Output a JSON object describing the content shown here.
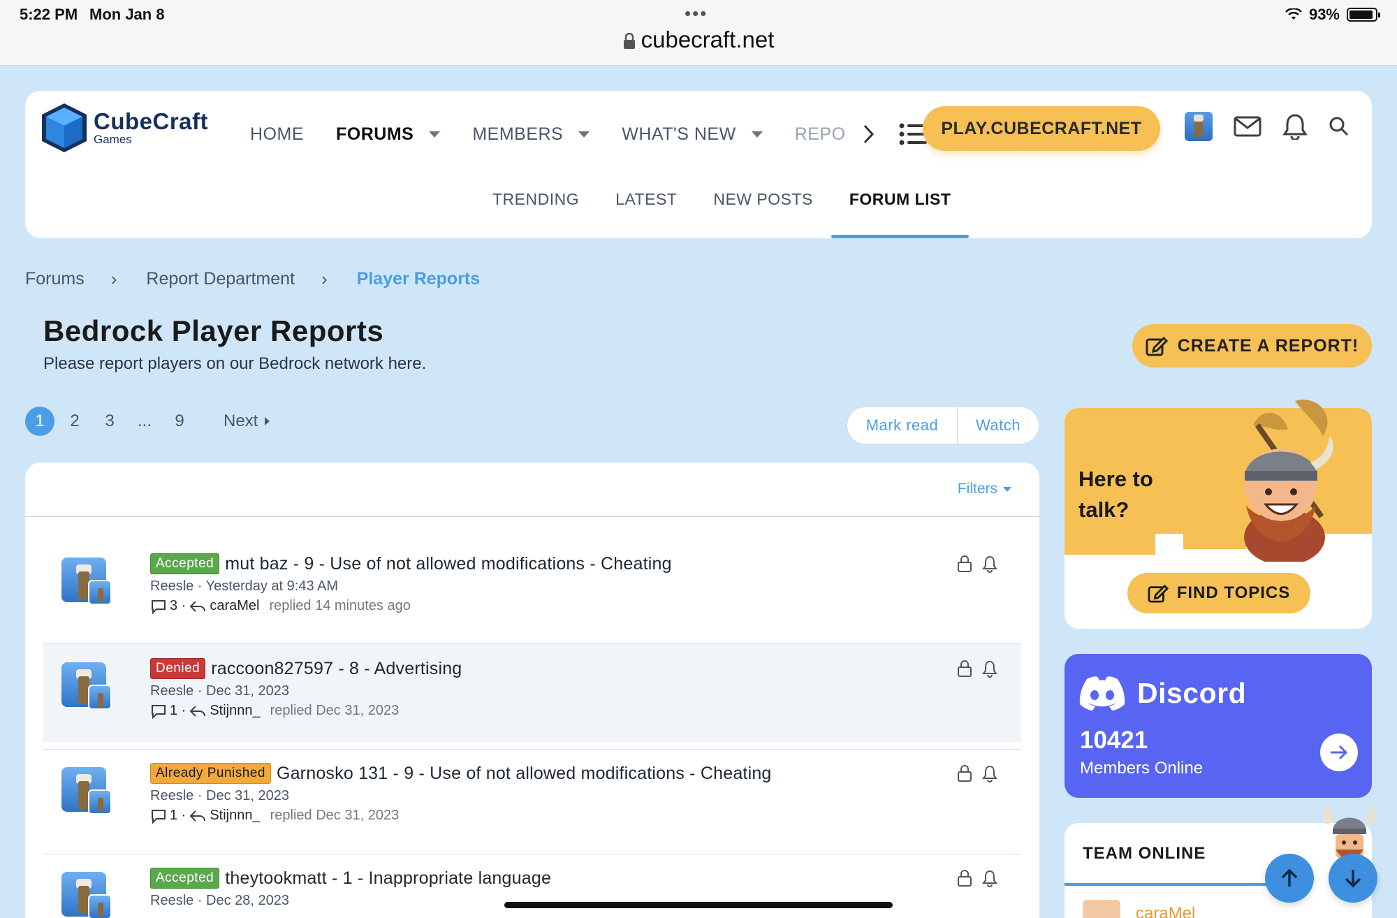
{
  "status_bar": {
    "time": "5:22 PM",
    "date": "Mon Jan 8",
    "battery": "93%",
    "dots": "•••"
  },
  "browser": {
    "url": "cubecraft.net"
  },
  "header": {
    "logo_name": "CubeCraft",
    "logo_sub": "Games",
    "nav": [
      {
        "label": "HOME"
      },
      {
        "label": "FORUMS"
      },
      {
        "label": "MEMBERS"
      },
      {
        "label": "WHAT'S NEW"
      },
      {
        "label": "REPO"
      }
    ],
    "play_button": "PLAY.CUBECRAFT.NET",
    "subnav": [
      {
        "label": "TRENDING"
      },
      {
        "label": "LATEST"
      },
      {
        "label": "NEW POSTS"
      },
      {
        "label": "FORUM LIST"
      }
    ]
  },
  "breadcrumb": [
    "Forums",
    "Report Department",
    "Player Reports"
  ],
  "page": {
    "title": "Bedrock Player Reports",
    "description": "Please report players on our Bedrock network here.",
    "create_button": "CREATE A REPORT!"
  },
  "pagination": {
    "pages": [
      "1",
      "2",
      "3",
      "...",
      "9"
    ],
    "current": "1",
    "next": "Next"
  },
  "actions": {
    "mark_read": "Mark read",
    "watch": "Watch"
  },
  "filters_label": "Filters",
  "threads": [
    {
      "prefix": "Accepted",
      "prefix_color": "#5aa84b",
      "title": "mut baz - 9 - Use of not allowed modifications - Cheating",
      "meta": "Reesle · Yesterday at 9:43 AM",
      "replies": "3 ·",
      "last_user": "caraMel",
      "last_time": "replied 14 minutes ago"
    },
    {
      "prefix": "Denied",
      "prefix_color": "#c93a37",
      "title": "raccoon827597 - 8 - Advertising",
      "meta": "Reesle · Dec 31, 2023",
      "replies": "1 ·",
      "last_user": "Stijnnn_",
      "last_time": "replied Dec 31, 2023"
    },
    {
      "prefix": "Already Punished",
      "prefix_color": "#f2a93c",
      "title": "Garnosko 131 - 9 - Use of not allowed modifications - Cheating",
      "meta": "Reesle · Dec 31, 2023",
      "replies": "1 ·",
      "last_user": "Stijnnn_",
      "last_time": "replied Dec 31, 2023"
    },
    {
      "prefix": "Accepted",
      "prefix_color": "#5aa84b",
      "title": "theytookmatt - 1 - Inappropriate language",
      "meta": "Reesle · Dec 28, 2023"
    }
  ],
  "sidebar": {
    "promo_text_1": "Here to",
    "promo_text_2": "talk?",
    "promo_button": "FIND TOPICS",
    "discord_name": "Discord",
    "discord_count": "10421",
    "discord_label": "Members Online",
    "team_title": "TEAM ONLINE",
    "team_member": "caraMel"
  },
  "colors": {
    "accent": "#4a9ee6",
    "brand_yellow": "#f6c055",
    "discord": "#5865f2",
    "background": "#cfe6f8"
  }
}
